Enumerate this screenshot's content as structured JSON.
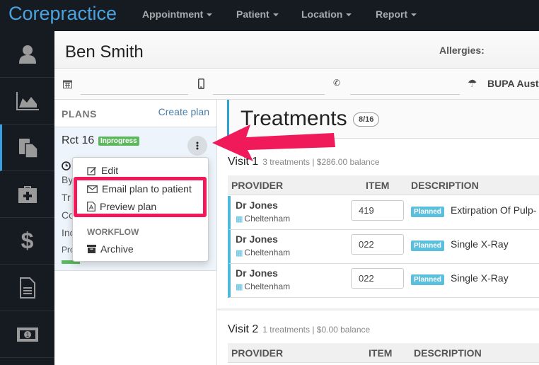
{
  "topbar": {
    "brand": "Corepractice",
    "nav": [
      {
        "label": "Appointment"
      },
      {
        "label": "Patient"
      },
      {
        "label": "Location"
      },
      {
        "label": "Report"
      }
    ]
  },
  "sidebar": {
    "items": [
      {
        "icon": "user-icon"
      },
      {
        "icon": "chart-area-icon"
      },
      {
        "icon": "documents-icon",
        "active": true
      },
      {
        "icon": "medkit-icon"
      },
      {
        "icon": "dollar-icon"
      },
      {
        "icon": "file-text-icon"
      },
      {
        "icon": "money-icon"
      }
    ]
  },
  "patient": {
    "name": "Ben Smith",
    "allergies_label": "Allergies:",
    "dob": "",
    "mobile": "",
    "phone": "",
    "insurer": "BUPA Aust"
  },
  "plans": {
    "title": "PLANS",
    "create_label": "Create plan",
    "plan": {
      "name": "Rct 16",
      "status": "Inprogress",
      "lines": [
        "By",
        "Tr",
        "Co",
        "Inc",
        "Pro"
      ],
      "progress": 0.3
    }
  },
  "dropdown": {
    "edit": "Edit",
    "email": "Email plan to patient",
    "preview": "Preview plan",
    "workflow_header": "WORKFLOW",
    "archive": "Archive"
  },
  "treatments": {
    "title": "Treatments",
    "count": "8/16",
    "columns": {
      "provider": "PROVIDER",
      "item": "ITEM",
      "description": "DESCRIPTION"
    },
    "visits": [
      {
        "title": "Visit 1",
        "meta": "3 treatments | $286.00 balance",
        "rows": [
          {
            "provider": "Dr Jones",
            "location": "Cheltenham",
            "item": "419",
            "status": "Planned",
            "description": "Extirpation Of Pulp-"
          },
          {
            "provider": "Dr Jones",
            "location": "Cheltenham",
            "item": "022",
            "status": "Planned",
            "description": "Single X-Ray"
          },
          {
            "provider": "Dr Jones",
            "location": "Cheltenham",
            "item": "022",
            "status": "Planned",
            "description": "Single X-Ray"
          }
        ]
      },
      {
        "title": "Visit 2",
        "meta": "1 treatments | $0.00 balance",
        "rows": []
      }
    ]
  },
  "annotation": {
    "color": "#f0195a"
  }
}
